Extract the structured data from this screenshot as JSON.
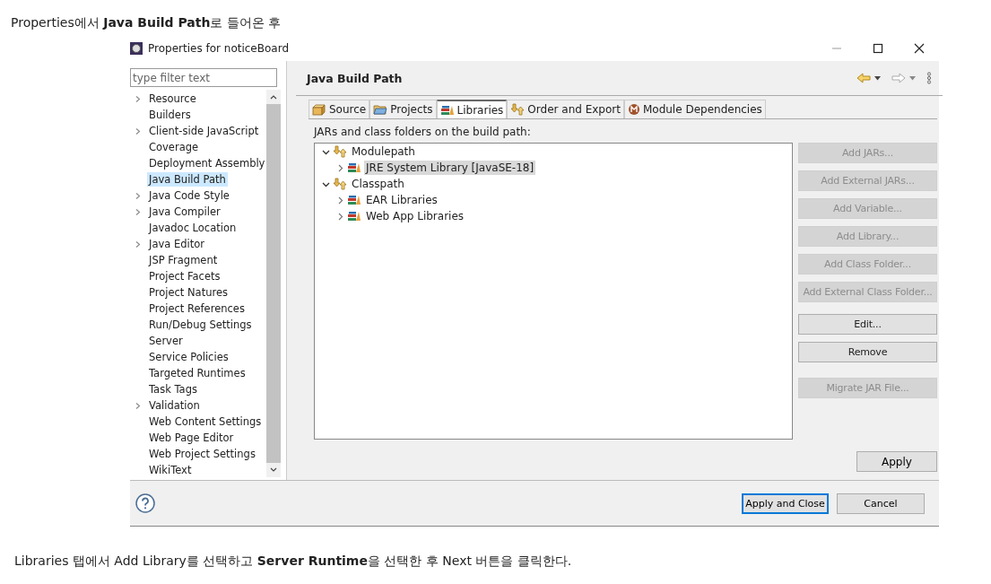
{
  "caption_top": "Properties에서 **Java Build Path**로 들어온 후",
  "dialog": {
    "title": "Properties for noticeBoard",
    "filter": {
      "placeholder": "type filter text"
    },
    "nav_items": [
      {
        "label": "Resource",
        "has_children": true,
        "selected": false
      },
      {
        "label": "Builders",
        "has_children": false,
        "selected": false
      },
      {
        "label": "Client-side JavaScript",
        "has_children": true,
        "selected": false
      },
      {
        "label": "Coverage",
        "has_children": false,
        "selected": false
      },
      {
        "label": "Deployment Assembly",
        "has_children": false,
        "selected": false
      },
      {
        "label": "Java Build Path",
        "has_children": false,
        "selected": true
      },
      {
        "label": "Java Code Style",
        "has_children": true,
        "selected": false
      },
      {
        "label": "Java Compiler",
        "has_children": true,
        "selected": false
      },
      {
        "label": "Javadoc Location",
        "has_children": false,
        "selected": false
      },
      {
        "label": "Java Editor",
        "has_children": true,
        "selected": false
      },
      {
        "label": "JSP Fragment",
        "has_children": false,
        "selected": false
      },
      {
        "label": "Project Facets",
        "has_children": false,
        "selected": false
      },
      {
        "label": "Project Natures",
        "has_children": false,
        "selected": false
      },
      {
        "label": "Project References",
        "has_children": false,
        "selected": false
      },
      {
        "label": "Run/Debug Settings",
        "has_children": false,
        "selected": false
      },
      {
        "label": "Server",
        "has_children": false,
        "selected": false
      },
      {
        "label": "Service Policies",
        "has_children": false,
        "selected": false
      },
      {
        "label": "Targeted Runtimes",
        "has_children": false,
        "selected": false
      },
      {
        "label": "Task Tags",
        "has_children": false,
        "selected": false
      },
      {
        "label": "Validation",
        "has_children": true,
        "selected": false
      },
      {
        "label": "Web Content Settings",
        "has_children": false,
        "selected": false
      },
      {
        "label": "Web Page Editor",
        "has_children": false,
        "selected": false
      },
      {
        "label": "Web Project Settings",
        "has_children": false,
        "selected": false
      },
      {
        "label": "WikiText",
        "has_children": false,
        "selected": false
      }
    ],
    "page_title": "Java Build Path",
    "tabs": [
      {
        "label": "Source",
        "kind": "source",
        "selected": false
      },
      {
        "label": "Projects",
        "kind": "projects",
        "selected": false
      },
      {
        "label": "Libraries",
        "kind": "libraries",
        "selected": true
      },
      {
        "label": "Order and Export",
        "kind": "order",
        "selected": false
      },
      {
        "label": "Module Dependencies",
        "kind": "module",
        "selected": false
      }
    ],
    "tree_label": "JARs and class folders on the build path:",
    "tree": [
      {
        "label": "Modulepath",
        "kind": "path",
        "expanded": true,
        "selected": false,
        "children": [
          {
            "label": "JRE System Library [JavaSE-18]",
            "kind": "library",
            "expanded": false,
            "selected": true
          }
        ]
      },
      {
        "label": "Classpath",
        "kind": "path",
        "expanded": true,
        "selected": false,
        "children": [
          {
            "label": "EAR Libraries",
            "kind": "library",
            "expanded": false,
            "selected": false
          },
          {
            "label": "Web App Libraries",
            "kind": "library",
            "expanded": false,
            "selected": false
          }
        ]
      }
    ],
    "button_groups": [
      [
        {
          "label": "Add JARs...",
          "disabled": true
        },
        {
          "label": "Add External JARs...",
          "disabled": true
        },
        {
          "label": "Add Variable...",
          "disabled": true
        },
        {
          "label": "Add Library...",
          "disabled": true
        },
        {
          "label": "Add Class Folder...",
          "disabled": true
        },
        {
          "label": "Add External Class Folder...",
          "disabled": true
        }
      ],
      [
        {
          "label": "Edit...",
          "disabled": false
        },
        {
          "label": "Remove",
          "disabled": false
        }
      ],
      [
        {
          "label": "Migrate JAR File...",
          "disabled": true
        }
      ]
    ],
    "apply": "Apply",
    "apply_and_close": "Apply and Close",
    "cancel": "Cancel"
  },
  "caption_bottom": "Libraries 탭에서 Add Library를 선택하고 **Server Runtime**을 선택한 후 Next 버튼을 클릭한다."
}
